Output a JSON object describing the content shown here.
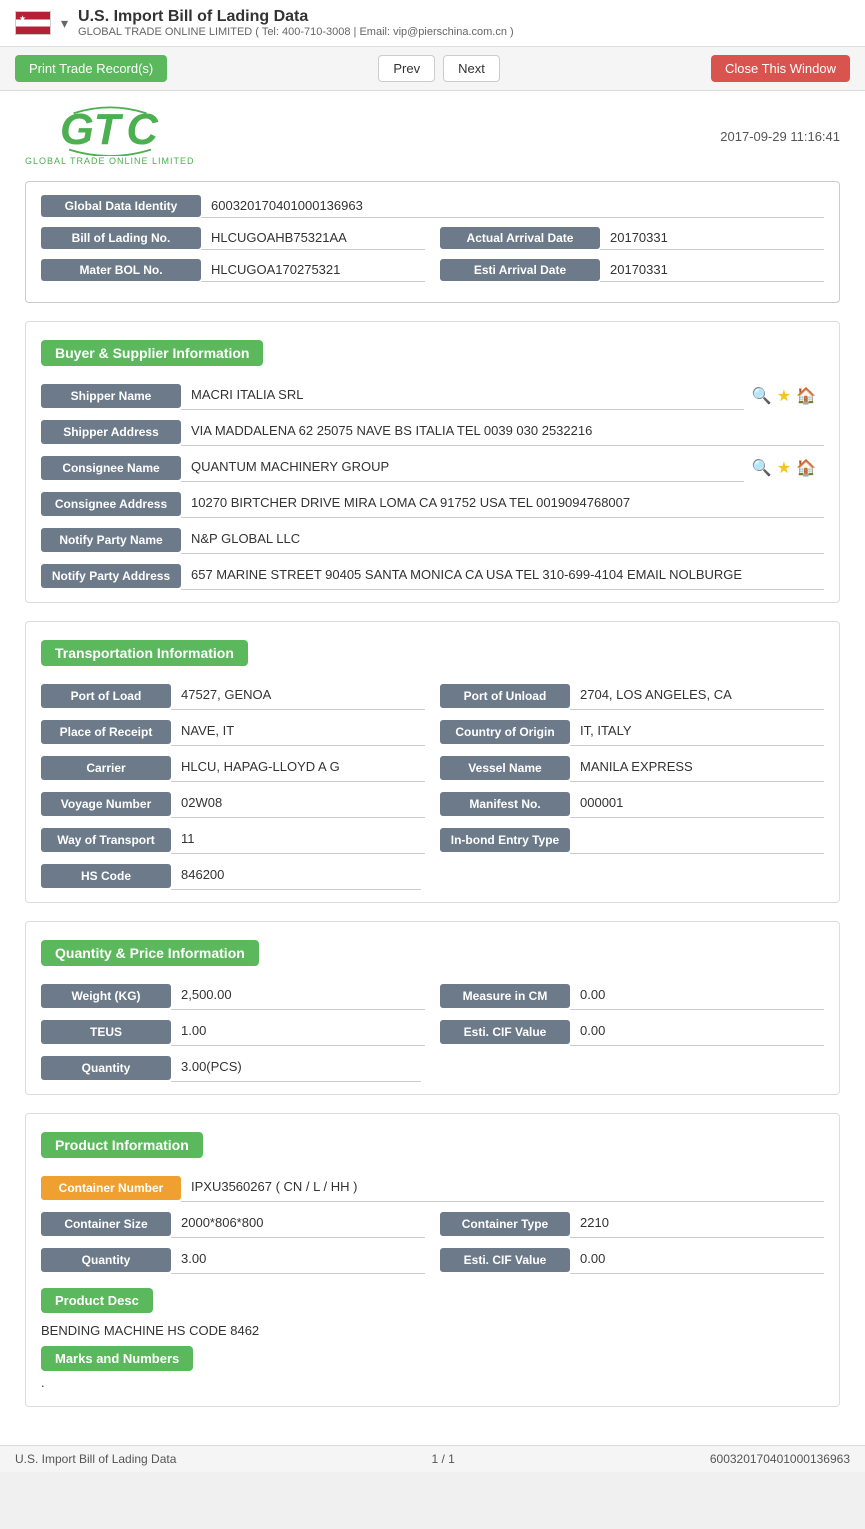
{
  "header": {
    "title": "U.S. Import Bill of Lading Data",
    "subtitle": "GLOBAL TRADE ONLINE LIMITED ( Tel: 400-710-3008 | Email: vip@pierschina.com.cn )",
    "dropdown_arrow": "▾"
  },
  "toolbar": {
    "print_label": "Print Trade Record(s)",
    "prev_label": "Prev",
    "next_label": "Next",
    "close_label": "Close This Window"
  },
  "logo": {
    "text": "GTC",
    "subtext": "GLOBAL TRADE ONLINE LIMITED",
    "timestamp": "2017-09-29 11:16:41"
  },
  "identity": {
    "global_data_identity_label": "Global Data Identity",
    "global_data_identity_value": "600320170401000136963",
    "bill_of_lading_label": "Bill of Lading No.",
    "bill_of_lading_value": "HLCUGOAHB75321AA",
    "actual_arrival_label": "Actual Arrival Date",
    "actual_arrival_value": "20170331",
    "master_bol_label": "Mater BOL No.",
    "master_bol_value": "HLCUGOA170275321",
    "esti_arrival_label": "Esti Arrival Date",
    "esti_arrival_value": "20170331"
  },
  "buyer_supplier": {
    "section_title": "Buyer & Supplier Information",
    "shipper_name_label": "Shipper Name",
    "shipper_name_value": "MACRI ITALIA SRL",
    "shipper_address_label": "Shipper Address",
    "shipper_address_value": "VIA MADDALENA 62 25075 NAVE BS ITALIA TEL 0039 030 2532216",
    "consignee_name_label": "Consignee Name",
    "consignee_name_value": "QUANTUM MACHINERY GROUP",
    "consignee_address_label": "Consignee Address",
    "consignee_address_value": "10270 BIRTCHER DRIVE MIRA LOMA CA 91752 USA TEL 0019094768007",
    "notify_party_label": "Notify Party Name",
    "notify_party_value": "N&P GLOBAL LLC",
    "notify_address_label": "Notify Party Address",
    "notify_address_value": "657 MARINE STREET 90405 SANTA MONICA CA USA TEL 310-699-4104 EMAIL NOLBURGE"
  },
  "transportation": {
    "section_title": "Transportation Information",
    "port_of_load_label": "Port of Load",
    "port_of_load_value": "47527, GENOA",
    "port_of_unload_label": "Port of Unload",
    "port_of_unload_value": "2704, LOS ANGELES, CA",
    "place_of_receipt_label": "Place of Receipt",
    "place_of_receipt_value": "NAVE, IT",
    "country_of_origin_label": "Country of Origin",
    "country_of_origin_value": "IT, ITALY",
    "carrier_label": "Carrier",
    "carrier_value": "HLCU, HAPAG-LLOYD A G",
    "vessel_name_label": "Vessel Name",
    "vessel_name_value": "MANILA EXPRESS",
    "voyage_number_label": "Voyage Number",
    "voyage_number_value": "02W08",
    "manifest_no_label": "Manifest No.",
    "manifest_no_value": "000001",
    "way_of_transport_label": "Way of Transport",
    "way_of_transport_value": "11",
    "in_bond_entry_label": "In-bond Entry Type",
    "in_bond_entry_value": "",
    "hs_code_label": "HS Code",
    "hs_code_value": "846200"
  },
  "quantity_price": {
    "section_title": "Quantity & Price Information",
    "weight_kg_label": "Weight (KG)",
    "weight_kg_value": "2,500.00",
    "measure_cm_label": "Measure in CM",
    "measure_cm_value": "0.00",
    "teus_label": "TEUS",
    "teus_value": "1.00",
    "esti_cif_label": "Esti. CIF Value",
    "esti_cif_value": "0.00",
    "quantity_label": "Quantity",
    "quantity_value": "3.00(PCS)"
  },
  "product_info": {
    "section_title": "Product Information",
    "container_number_label": "Container Number",
    "container_number_value": "IPXU3560267 ( CN / L / HH )",
    "container_size_label": "Container Size",
    "container_size_value": "2000*806*800",
    "container_type_label": "Container Type",
    "container_type_value": "2210",
    "quantity_label": "Quantity",
    "quantity_value": "3.00",
    "esti_cif_label": "Esti. CIF Value",
    "esti_cif_value": "0.00",
    "product_desc_btn": "Product Desc",
    "product_desc_text": "BENDING MACHINE HS CODE 8462",
    "marks_btn": "Marks and Numbers",
    "marks_value": "."
  },
  "footer": {
    "left": "U.S. Import Bill of Lading Data",
    "center": "1 / 1",
    "right": "600320170401000136963"
  }
}
